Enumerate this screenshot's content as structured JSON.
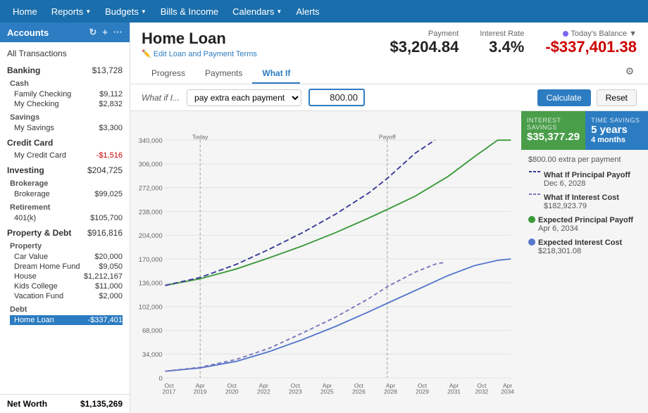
{
  "nav": {
    "items": [
      {
        "label": "Home",
        "active": false
      },
      {
        "label": "Reports",
        "dropdown": true
      },
      {
        "label": "Budgets",
        "dropdown": true
      },
      {
        "label": "Bills & Income",
        "active": false
      },
      {
        "label": "Calendars",
        "dropdown": true
      },
      {
        "label": "Alerts",
        "active": false
      }
    ]
  },
  "sidebar": {
    "title": "Accounts",
    "all_transactions": "All Transactions",
    "sections": [
      {
        "label": "Banking",
        "amount": "$13,728",
        "expanded": true,
        "subsections": [
          {
            "label": "Cash",
            "items": [
              {
                "name": "Family Checking",
                "amount": "$9,112"
              },
              {
                "name": "My Checking",
                "amount": "$2,832"
              }
            ]
          },
          {
            "label": "Savings",
            "items": [
              {
                "name": "My Savings",
                "amount": "$3,300"
              }
            ]
          }
        ]
      },
      {
        "label": "Credit Card",
        "amount": "",
        "expanded": true,
        "subsections": [
          {
            "label": "",
            "items": [
              {
                "name": "My Credit Card",
                "amount": "-$1,516",
                "negative": true
              }
            ]
          }
        ]
      },
      {
        "label": "Investing",
        "amount": "$204,725",
        "expanded": true,
        "subsections": [
          {
            "label": "Brokerage",
            "items": [
              {
                "name": "Brokerage",
                "amount": "$99,025"
              }
            ]
          },
          {
            "label": "Retirement",
            "items": [
              {
                "name": "401(k)",
                "amount": "$105,700"
              }
            ]
          }
        ]
      },
      {
        "label": "Property & Debt",
        "amount": "$916,816",
        "expanded": true,
        "subsections": [
          {
            "label": "Property",
            "items": [
              {
                "name": "Car Value",
                "amount": "$20,000"
              },
              {
                "name": "Dream Home Fund",
                "amount": "$9,050"
              },
              {
                "name": "House",
                "amount": "$1,212,167"
              },
              {
                "name": "Kids College",
                "amount": "$11,000"
              },
              {
                "name": "Vacation Fund",
                "amount": "$2,000"
              }
            ]
          },
          {
            "label": "Debt",
            "items": [
              {
                "name": "Home Loan",
                "amount": "-$337,401",
                "negative": true,
                "active": true
              }
            ]
          }
        ]
      }
    ],
    "net_worth_label": "Net Worth",
    "net_worth_value": "$1,135,269"
  },
  "page": {
    "title": "Home Loan",
    "edit_label": "Edit Loan and Payment Terms",
    "payment_label": "Payment",
    "payment_value": "$3,204.84",
    "interest_label": "Interest Rate",
    "interest_value": "3.4%",
    "today_label": "Today's Balance",
    "today_value": "-$337,401.38",
    "tabs": [
      "Progress",
      "Payments",
      "What If"
    ],
    "active_tab": "What If"
  },
  "whatif": {
    "label": "What if I...",
    "select_value": "pay extra each payment",
    "input_value": "800.00",
    "calculate_label": "Calculate",
    "reset_label": "Reset"
  },
  "savings_panel": {
    "interest_savings_label": "INTEREST SAVINGS",
    "interest_savings_value": "$35,377.29",
    "time_savings_label": "TIME SAVINGS",
    "time_savings_value": "5 years",
    "time_savings_sub": "4 months"
  },
  "chart_info": {
    "extra_payment": "$800.00 extra per payment",
    "legend": [
      {
        "type": "dashed-dark",
        "title": "What If Principal Payoff",
        "subtitle": "Dec 6, 2028"
      },
      {
        "type": "dashed-light",
        "title": "What If Interest Cost",
        "subtitle": "$182,923.79"
      },
      {
        "type": "solid-green",
        "title": "Expected Principal Payoff",
        "subtitle": "Apr 6, 2034"
      },
      {
        "type": "solid-blue",
        "title": "Expected Interest Cost",
        "subtitle": "$218,301.08"
      }
    ]
  },
  "chart": {
    "y_labels": [
      "340,000",
      "306,000",
      "272,000",
      "238,000",
      "204,000",
      "170,000",
      "136,000",
      "102,000",
      "68,000",
      "34,000",
      "0"
    ],
    "x_labels": [
      "Oct\n2017",
      "Apr\n2019",
      "Oct\n2020",
      "Apr\n2022",
      "Oct\n2023",
      "Apr\n2025",
      "Oct\n2026",
      "Apr\n2028",
      "Oct\n2029",
      "Apr\n2031",
      "Oct\n2032",
      "Apr\n2034"
    ],
    "today_label": "Today",
    "payoff_label": "Payoff"
  }
}
